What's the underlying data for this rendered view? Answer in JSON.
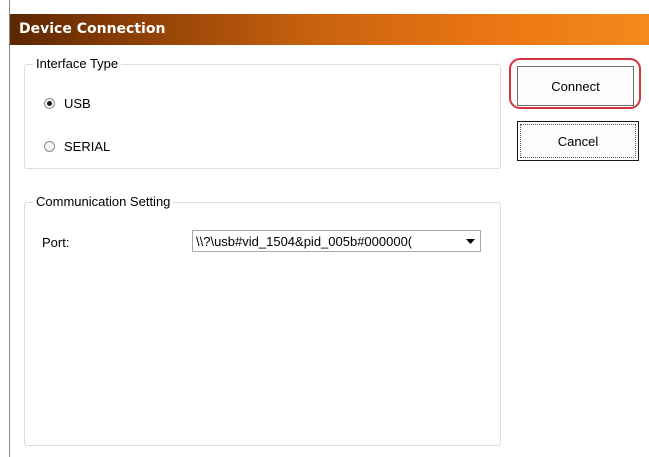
{
  "window": {
    "title": "Device Connection"
  },
  "interface_type": {
    "legend": "Interface Type",
    "options": [
      {
        "label": "USB",
        "checked": true
      },
      {
        "label": "SERIAL",
        "checked": false
      }
    ]
  },
  "communication": {
    "legend": "Communication Setting",
    "port_label": "Port:",
    "port_value": "\\\\?\\usb#vid_1504&pid_005b#000000("
  },
  "buttons": {
    "connect": "Connect",
    "cancel": "Cancel"
  },
  "icons": {
    "dropdown": "chevron-down-icon"
  },
  "colors": {
    "title_start": "#5b2600",
    "title_end": "#f58a1c",
    "highlight": "#d3353d"
  }
}
